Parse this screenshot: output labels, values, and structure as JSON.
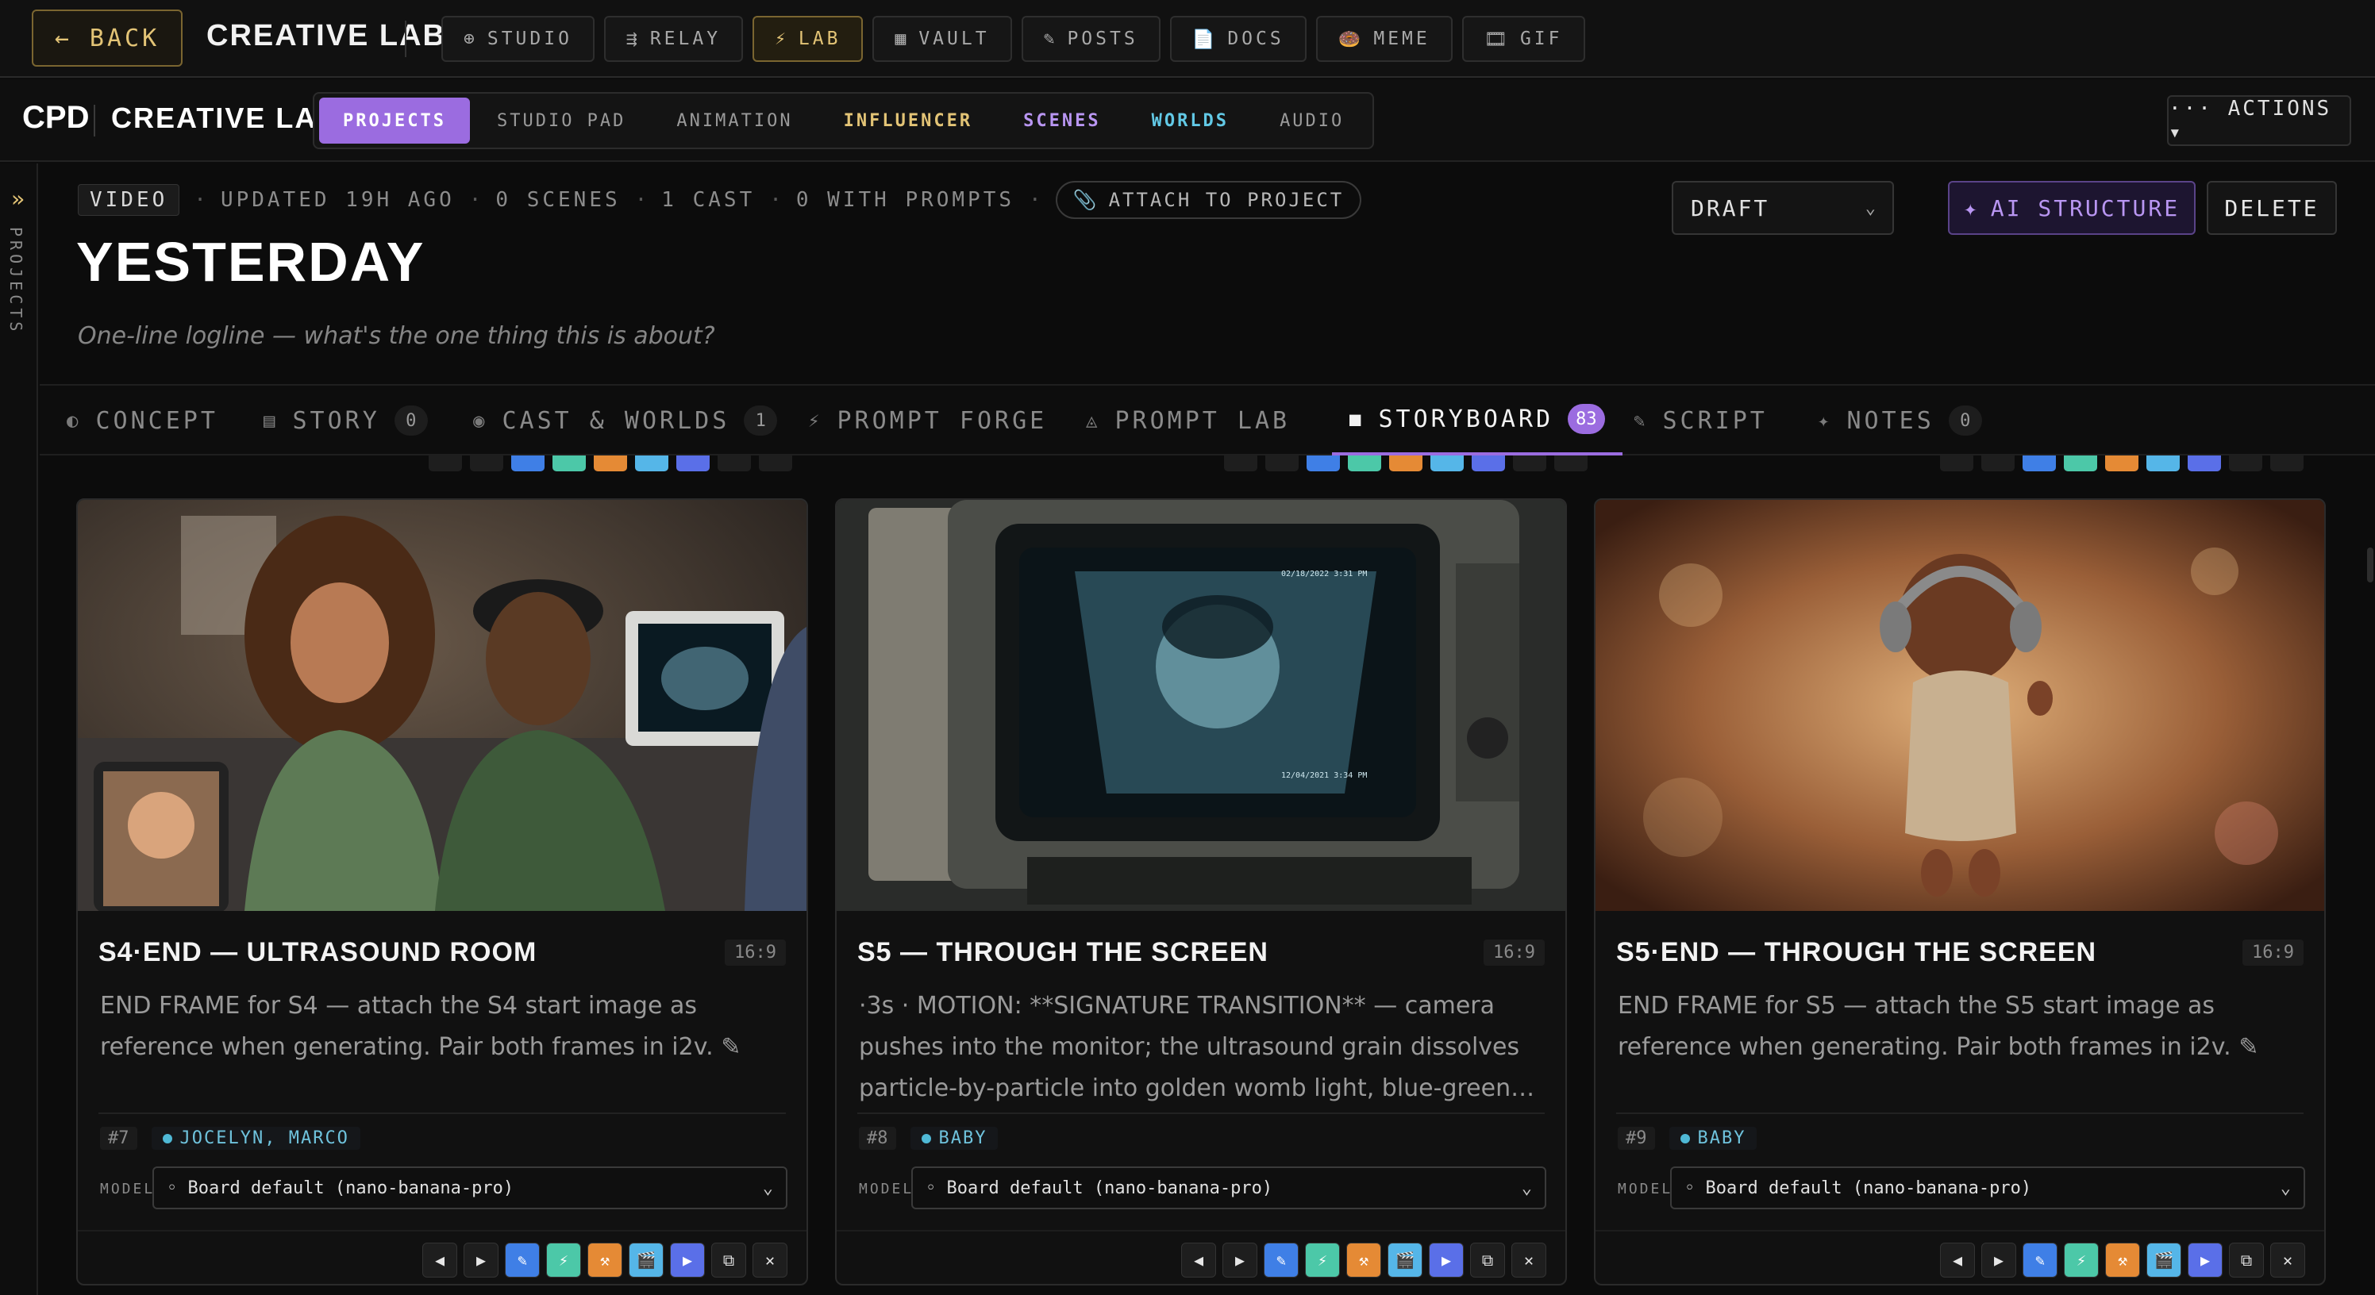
{
  "topbar": {
    "back_label": "← BACK",
    "title": "CREATIVE LAB",
    "nav": [
      {
        "icon": "⊕",
        "label": "STUDIO",
        "active": false
      },
      {
        "icon": "⇶",
        "label": "RELAY",
        "active": false
      },
      {
        "icon": "⚡",
        "label": "LAB",
        "active": true
      },
      {
        "icon": "▦",
        "label": "VAULT",
        "active": false
      },
      {
        "icon": "✎",
        "label": "POSTS",
        "active": false
      },
      {
        "icon": "📄",
        "label": "DOCS",
        "active": false
      },
      {
        "icon": "🍩",
        "label": "MEME",
        "active": false
      },
      {
        "icon": "🎞",
        "label": "GIF",
        "active": false
      }
    ]
  },
  "subbar": {
    "brand_short": "CPD",
    "brand_name": "CREATIVE LAB",
    "tabs": [
      {
        "label": "PROJECTS",
        "color": "#ffffff",
        "active": true
      },
      {
        "label": "STUDIO PAD",
        "color": "#9a9a9a",
        "active": false
      },
      {
        "label": "ANIMATION",
        "color": "#9a9a9a",
        "active": false
      },
      {
        "label": "INFLUENCER",
        "color": "#e3c476",
        "active": false
      },
      {
        "label": "SCENES",
        "color": "#b996f2",
        "active": false
      },
      {
        "label": "WORLDS",
        "color": "#62c9e6",
        "active": false
      },
      {
        "label": "AUDIO",
        "color": "#9a9a9a",
        "active": false
      }
    ],
    "actions_label": "··· ACTIONS ▾"
  },
  "rail": {
    "chevron": "»",
    "label": "PROJECTS"
  },
  "project": {
    "type_badge": "VIDEO",
    "meta": [
      "UPDATED 19H AGO",
      "0 SCENES",
      "1 CAST",
      "0 WITH PROMPTS"
    ],
    "attach_label": "ATTACH TO PROJECT",
    "title": "YESTERDAY",
    "logline_placeholder": "One-line logline — what's the one thing this is about?",
    "status_value": "DRAFT",
    "ai_label": "AI STRUCTURE",
    "delete_label": "DELETE"
  },
  "section_tabs": [
    {
      "icon": "◐",
      "label": "CONCEPT",
      "count": null,
      "active": false
    },
    {
      "icon": "▤",
      "label": "STORY",
      "count": "0",
      "active": false
    },
    {
      "icon": "◉",
      "label": "CAST & WORLDS",
      "count": "1",
      "active": false
    },
    {
      "icon": "⚡",
      "label": "PROMPT FORGE",
      "count": null,
      "active": false
    },
    {
      "icon": "◬",
      "label": "PROMPT LAB",
      "count": null,
      "active": false
    },
    {
      "icon": "■",
      "label": "STORYBOARD",
      "count": "83",
      "active": true
    },
    {
      "icon": "✎",
      "label": "SCRIPT",
      "count": null,
      "active": false
    },
    {
      "icon": "✦",
      "label": "NOTES",
      "count": "0",
      "active": false
    }
  ],
  "cards": [
    {
      "title": "S4·END — ULTRASOUND ROOM",
      "ratio": "16:9",
      "description": "END FRAME for S4 — attach the S4 start image as reference when generating. Pair both frames in i2v. ✎",
      "number": "#7",
      "cast": "JOCELYN, MARCO",
      "model_label": "MODEL",
      "model_value": "◦ Board default (nano-banana-pro)"
    },
    {
      "title": "S5 — THROUGH THE SCREEN",
      "ratio": "16:9",
      "description": "·3s · MOTION: **SIGNATURE TRANSITION** — camera pushes into the monitor; the ultrasound grain dissolves particle-by-particle into golden womb light, blue-green…",
      "number": "#8",
      "cast": "BABY",
      "model_label": "MODEL",
      "model_value": "◦ Board default (nano-banana-pro)",
      "monitor_text_top": "02/18/2022 3:31 PM",
      "monitor_text_bottom": "12/04/2021 3:34 PM"
    },
    {
      "title": "S5·END — THROUGH THE SCREEN",
      "ratio": "16:9",
      "description": "END FRAME for S5 — attach the S5 start image as reference when generating. Pair both frames in i2v. ✎",
      "number": "#9",
      "cast": "BABY",
      "model_label": "MODEL",
      "model_value": "◦ Board default (nano-banana-pro)"
    }
  ],
  "toolbar_icons": [
    {
      "name": "prev-icon",
      "glyph": "◀",
      "style": "dark"
    },
    {
      "name": "next-icon",
      "glyph": "▶",
      "style": "dark"
    },
    {
      "name": "edit-icon",
      "glyph": "✎",
      "style": "blue"
    },
    {
      "name": "lightning-icon",
      "glyph": "⚡",
      "style": "teal"
    },
    {
      "name": "tools-icon",
      "glyph": "⚒",
      "style": "orange"
    },
    {
      "name": "clapper-icon",
      "glyph": "🎬",
      "style": "sky"
    },
    {
      "name": "play-icon",
      "glyph": "▶",
      "style": "indigo"
    },
    {
      "name": "copy-icon",
      "glyph": "⧉",
      "style": "dark"
    },
    {
      "name": "close-icon",
      "glyph": "✕",
      "style": "dark"
    }
  ],
  "colors": {
    "accent_purple": "#9b6ce0",
    "accent_gold": "#e3c476",
    "cast_cyan": "#6fc3dd"
  }
}
